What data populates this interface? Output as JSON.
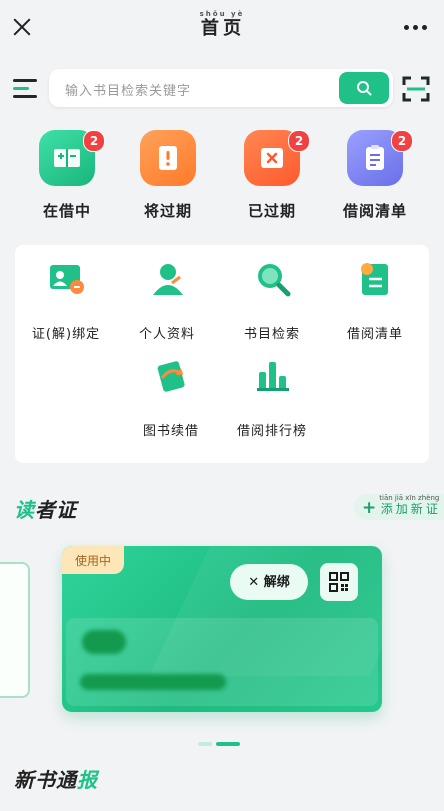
{
  "header": {
    "title": "首页",
    "title_pinyin": "shǒu yè"
  },
  "search": {
    "placeholder": "输入书目检索关键字"
  },
  "quick_links": [
    {
      "label": "在借中",
      "badge": "2",
      "color": "#1fc189",
      "icon": "book-plus-icon"
    },
    {
      "label": "将过期",
      "badge": "",
      "color": "#ff8a3d",
      "icon": "warning-book-icon"
    },
    {
      "label": "已过期",
      "badge": "2",
      "color": "#ff6a3d",
      "icon": "expired-book-icon"
    },
    {
      "label": "借阅清单",
      "badge": "2",
      "color": "#7a7ff0",
      "icon": "clipboard-list-icon"
    }
  ],
  "services": [
    {
      "label": "证(解)绑定",
      "icon": "card-bind-icon"
    },
    {
      "label": "个人资料",
      "icon": "person-icon"
    },
    {
      "label": "书目检索",
      "icon": "magnifier-icon"
    },
    {
      "label": "借阅清单",
      "icon": "list-star-icon"
    },
    {
      "label": "图书续借",
      "icon": "renew-book-icon"
    },
    {
      "label": "借阅排行榜",
      "icon": "bar-chart-icon"
    }
  ],
  "reader_card_section": {
    "title_prefix": "读",
    "title_rest": "者证",
    "add_button": "添加新证",
    "add_button_pinyin": "tiān jiā xīn zhèng"
  },
  "reader_card": {
    "status": "使用中",
    "unbind_label": "解绑",
    "carousel_active_index": 1
  },
  "news_section": {
    "title_rest": "新书通",
    "title_accent": "报"
  },
  "colors": {
    "accent": "#1fc189",
    "badge": "#f24141",
    "background": "#f2f3f5"
  }
}
